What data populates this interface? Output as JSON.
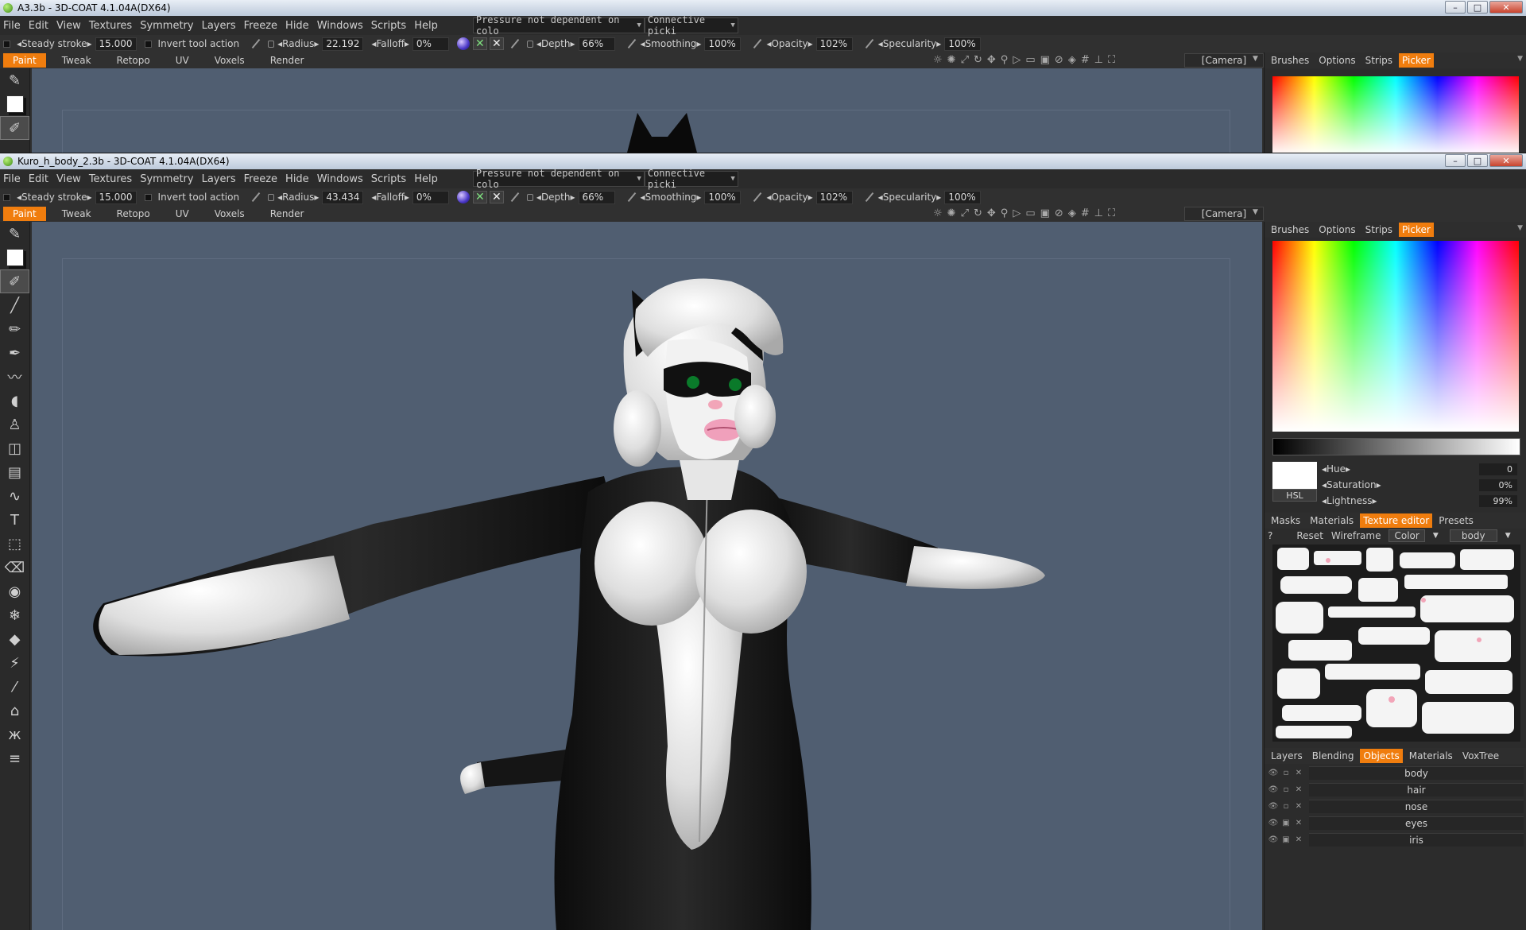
{
  "window_a": {
    "title": "A3.3b - 3D-COAT 4.1.04A(DX64)"
  },
  "window_b": {
    "title": "Kuro_h_body_2.3b - 3D-COAT 4.1.04A(DX64)"
  },
  "window_buttons": {
    "minimize": "–",
    "maximize": "□",
    "close": "✕"
  },
  "menu": [
    "File",
    "Edit",
    "View",
    "Textures",
    "Symmetry",
    "Layers",
    "Freeze",
    "Hide",
    "Windows",
    "Scripts",
    "Help"
  ],
  "menu_dropdowns": {
    "pressure": "Pressure not dependent on colo",
    "picking": "Connective picki"
  },
  "toolbar_a": {
    "steady_stroke_label": "Steady stroke",
    "steady_stroke_value": "15.000",
    "invert_label": "Invert tool action",
    "radius_label": "Radius",
    "radius_value": "22.192",
    "falloff_label": "Falloff",
    "falloff_value": "0%",
    "depth_label": "Depth",
    "depth_value": "66%",
    "smoothing_label": "Smoothing",
    "smoothing_value": "100%",
    "opacity_label": "Opacity",
    "opacity_value": "102%",
    "specularity_label": "Specularity",
    "specularity_value": "100%"
  },
  "toolbar_b": {
    "steady_stroke_label": "Steady stroke",
    "steady_stroke_value": "15.000",
    "invert_label": "Invert tool action",
    "radius_label": "Radius",
    "radius_value": "43.434",
    "falloff_label": "Falloff",
    "falloff_value": "0%",
    "depth_label": "Depth",
    "depth_value": "66%",
    "smoothing_label": "Smoothing",
    "smoothing_value": "100%",
    "opacity_label": "Opacity",
    "opacity_value": "102%",
    "specularity_label": "Specularity",
    "specularity_value": "100%"
  },
  "room_tabs": [
    "Paint",
    "Tweak",
    "Retopo",
    "UV",
    "Voxels",
    "Render"
  ],
  "camera_select": "[Camera]",
  "right_tabs": [
    "Brushes",
    "Options",
    "Strips",
    "Picker"
  ],
  "hsl": {
    "mode_button": "HSL",
    "hue_label": "Hue",
    "hue_value": "0",
    "saturation_label": "Saturation",
    "saturation_value": "0%",
    "lightness_label": "Lightness",
    "lightness_value": "99%"
  },
  "mid_tabs": [
    "Masks",
    "Materials",
    "Texture editor",
    "Presets"
  ],
  "texture_bar": {
    "help": "?",
    "reset": "Reset",
    "wireframe": "Wireframe",
    "channel": "Color",
    "object": "body"
  },
  "bottom_tabs": [
    "Layers",
    "Blending",
    "Objects",
    "Materials",
    "VoxTree"
  ],
  "objects": [
    "body",
    "hair",
    "nose",
    "eyes",
    "iris"
  ],
  "icons": {
    "viewport_tools": [
      "sun-icon",
      "light-icon",
      "scale-icon",
      "rotate-icon",
      "move-icon",
      "zoom-icon",
      "play-icon",
      "frame-all-icon",
      "frame-selected-icon",
      "no-icon",
      "shading-icon",
      "grid-icon",
      "axis-icon",
      "fit-icon"
    ],
    "left_tools": [
      "brush-icon",
      "line-icon",
      "pencil-icon",
      "airbrush-icon",
      "smudge-icon",
      "fill-icon",
      "stamp-icon",
      "transform-icon",
      "page-icon",
      "curve-icon",
      "text-icon",
      "frame-icon",
      "eraser-icon",
      "eye-icon",
      "snowflake-icon",
      "marker-icon",
      "wand-icon",
      "pipette-icon",
      "iron-icon",
      "butterfly-icon",
      "comb-icon"
    ]
  },
  "colors": {
    "accent": "#f07d0e",
    "viewport_bg": "#505e71",
    "panel_bg": "#2c2c2c"
  }
}
